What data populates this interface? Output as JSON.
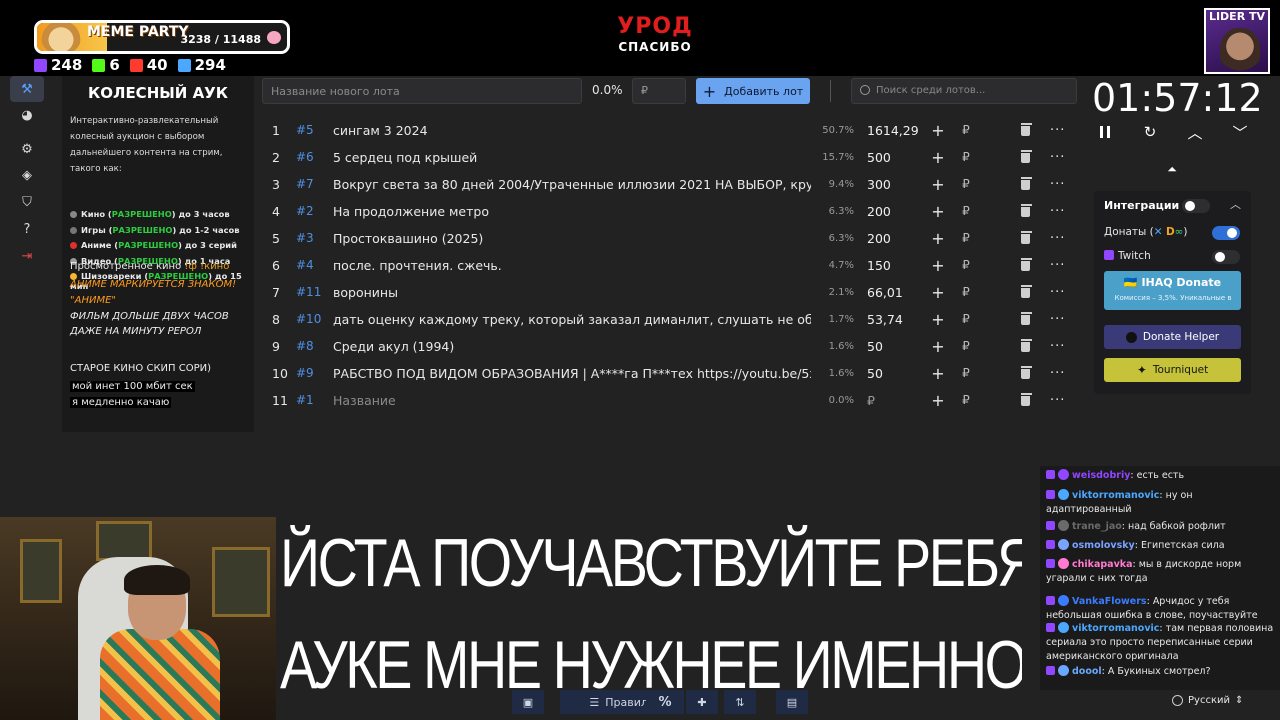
{
  "overlay": {
    "meme_title": "MEME PARTY",
    "meme_count": "3238 / 11488",
    "meme_progress": 0.28,
    "stats": [
      {
        "icon": "twitch-icon",
        "color": "#9146ff",
        "value": "248"
      },
      {
        "icon": "kick-icon",
        "color": "#53fc18",
        "value": "6"
      },
      {
        "icon": "vk-live-icon",
        "color": "#ff3b2f",
        "value": "40"
      },
      {
        "icon": "viewers-icon",
        "color": "#4aa8ff",
        "value": "294"
      }
    ],
    "ugly": "УРОД",
    "thanks": "СПАСИБО",
    "lider": "LIDER TV"
  },
  "info": {
    "title": "КОЛЕСНЫЙ АУК",
    "desc": "Интерактивно-развлекательный колесный аукцион с выбором дальнейшего контента на стрим, такого как:",
    "rules": [
      {
        "icon": "film-icon",
        "color": "#888",
        "name": "Кино",
        "status": "РАЗРЕШЕНО",
        "limit": "до 3 часов"
      },
      {
        "icon": "gamepad-icon",
        "color": "#777",
        "name": "Игры",
        "status": "РАЗРЕШЕНО",
        "limit": "до 1-2 часов"
      },
      {
        "icon": "anime-icon",
        "color": "#e0302a",
        "name": "Аниме",
        "status": "РАЗРЕШЕНО",
        "limit": "до 3 серий"
      },
      {
        "icon": "video-icon",
        "color": "#999",
        "name": "Видео",
        "status": "РАЗРЕШЕНО",
        "limit": "до 1 часа"
      },
      {
        "icon": "emoji-icon",
        "color": "#f2b632",
        "name": "Шизовареки",
        "status": "РАЗРЕШЕНО",
        "limit": "до 15 мин"
      }
    ],
    "kino_prefix": "Просмотренное кино",
    "kino_cmd": "!ф !кино",
    "anime_line1": "АНИМЕ МАРКИРУЕТСЯ ЗНАКОМ!",
    "anime_line2": "\"АНИМЕ\"",
    "film_line1": "ФИЛЬМ ДОЛЬШЕ ДВУХ ЧАСОВ",
    "film_line2": "ДАЖЕ НА МИНУТУ РЕРОЛ",
    "old_kino": "СТАРОЕ КИНО СКИП СОРИ)",
    "net1": "мой инет 100 мбит сек",
    "net2": "я медленно качаю"
  },
  "lot_form": {
    "name_placeholder": "Название нового лота",
    "pct": "0.0%",
    "amount_placeholder": "₽",
    "add_label": "Добавить лот",
    "search_placeholder": "Поиск среди лотов..."
  },
  "lots": [
    {
      "num": "1",
      "id": "#5",
      "name": "сингам 3 2024",
      "pct": "50.7%",
      "amount": "1614,29"
    },
    {
      "num": "2",
      "id": "#6",
      "name": "5 сердец под крышей",
      "pct": "15.7%",
      "amount": "500"
    },
    {
      "num": "3",
      "id": "#7",
      "name": "Вокруг света за 80 дней 2004/Утраченные иллюзии 2021 НА ВЫБОР, крутая",
      "pct": "9.4%",
      "amount": "300"
    },
    {
      "num": "4",
      "id": "#2",
      "name": "На продолжение метро",
      "pct": "6.3%",
      "amount": "200"
    },
    {
      "num": "5",
      "id": "#3",
      "name": "Простоквашино (2025)",
      "pct": "6.3%",
      "amount": "200"
    },
    {
      "num": "6",
      "id": "#4",
      "name": "после. прочтения. сжечь.",
      "pct": "4.7%",
      "amount": "150"
    },
    {
      "num": "7",
      "id": "#11",
      "name": "воронины",
      "pct": "2.1%",
      "amount": "66,01"
    },
    {
      "num": "8",
      "id": "#10",
      "name": "дать оценку каждому треку, который заказал диманлит, слушать не обязате.",
      "pct": "1.7%",
      "amount": "53,74"
    },
    {
      "num": "9",
      "id": "#8",
      "name": "Среди акул (1994)",
      "pct": "1.6%",
      "amount": "50"
    },
    {
      "num": "10",
      "id": "#9",
      "name": "РАБСТВО ПОД ВИДОМ ОБРАЗОВАНИЯ | А****га П***тех https://youtu.be/5xN",
      "pct": "1.6%",
      "amount": "50"
    },
    {
      "num": "11",
      "id": "#1",
      "name": "Название",
      "pct": "0.0%",
      "amount": "₽",
      "placeholder": true
    }
  ],
  "row_actions": {
    "plus": "+",
    "rub": "₽",
    "more": "···"
  },
  "timer": {
    "value": "01:57:12"
  },
  "integrations": {
    "title": "Интеграции",
    "donates": "Донаты (",
    "donates_close": ")",
    "twitch": "Twitch",
    "ihaq": "IHAQ Donate",
    "ihaq_sub": "Комиссия – 3,5%. Уникальные в",
    "donate_helper": "Donate Helper",
    "tourniquet": "Tourniquet"
  },
  "caption": {
    "line1": "ЙСТА ПОУЧАВСТВУЙТЕ РЕБЯТА ПОЖАЛУЙ",
    "line2": "АУКЕ МНЕ НУЖНЕЕ     ИМЕННО В МОЕМ"
  },
  "bottom": {
    "rules": "Правила",
    "percent": "%"
  },
  "chat": [
    {
      "nick": "weisdobriy",
      "color": "#9146ff",
      "text": "есть есть"
    },
    {
      "nick": "viktorromanovic",
      "color": "#4aa8ff",
      "text": "ну он адаптированный"
    },
    {
      "nick": "trane_jao",
      "color": "#6a6a6a",
      "text": "над бабкой рофлит"
    },
    {
      "nick": "osmolovsky",
      "color": "#7aa2ff",
      "text": "Египетская сила"
    },
    {
      "nick": "chikapavka",
      "color": "#ff7ad0",
      "text": "мы в дискорде норм угарали с них тогда"
    },
    {
      "nick": "VankaFlowers",
      "color": "#3b7cff",
      "text": "Арчидос у тебя небольшая ошибка в слове, поучаствуйте"
    },
    {
      "nick": "viktorromanovic",
      "color": "#4aa8ff",
      "text": "там первая половина сериала это просто переписанные серии американского оригинала"
    },
    {
      "nick": "doool",
      "color": "#6aa8ff",
      "text": "А Букиных смотрел?"
    }
  ],
  "language": "Русский"
}
